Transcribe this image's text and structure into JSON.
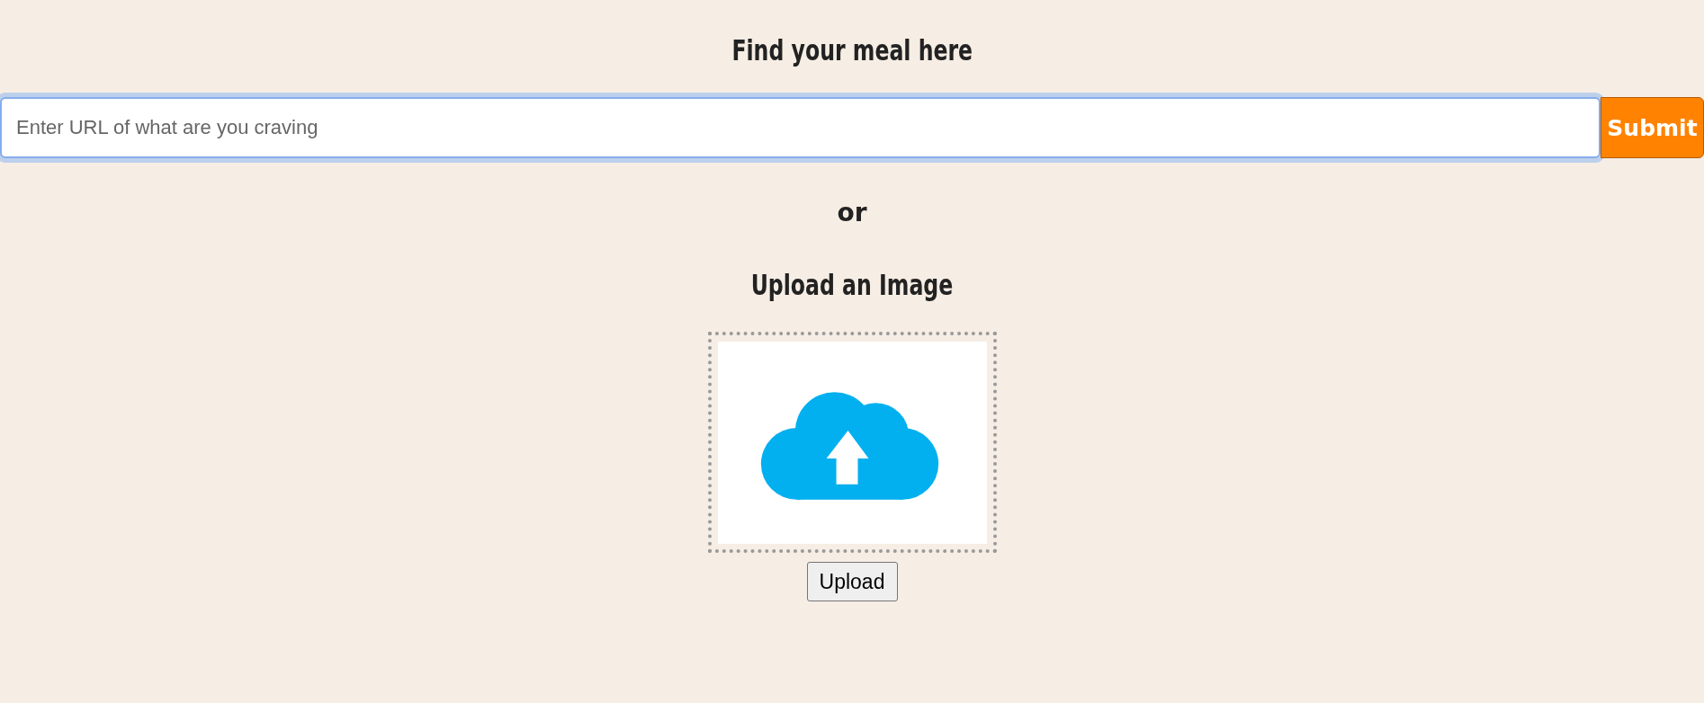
{
  "title": "Find your meal here",
  "search": {
    "placeholder": "Enter URL of what are you craving",
    "focused": true
  },
  "submit_button": "Submit",
  "separator": "or",
  "upload_heading": "Upload an Image",
  "dropzone": {
    "kind": "cloud-upload"
  },
  "upload_button": "Upload"
}
